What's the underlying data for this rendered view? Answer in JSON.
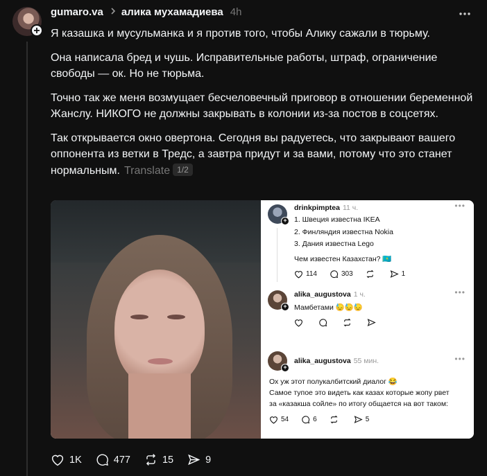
{
  "post": {
    "username": "gumaro.va",
    "reply_to": "алика мухамадиева",
    "time": "4h",
    "paragraphs": [
      "Я казашка и мусульманка и я против того, чтобы Алику сажали в тюрьму.",
      "Она написала бред и чушь. Исправительные работы, штраф, ограничение свободы — ок. Но не тюрьма.",
      "Точно так же меня возмущает бесчеловечный приговор в отношении беременной Жанслу. НИКОГО не должны закрывать в колонии из-за постов в соцсетях.",
      "Так открывается окно овертона. Сегодня вы радуетесь, что закрывают вашего оппонента из ветки в Тредс, а завтра придут и за вами, потому что это станет нормальным."
    ],
    "translate_label": "Translate",
    "pager": "1/2",
    "likes": "1K",
    "comments": "477",
    "reposts": "15",
    "shares": "9"
  },
  "screenshot": {
    "post1": {
      "name": "drinkpimptea",
      "time": "11 ч.",
      "lines": [
        "1. Швеция известна IKEA",
        "2. Финляндия известна Nokia",
        "3. Дания известна Lego",
        "Чем известен Казахстан? 🇰🇿"
      ],
      "likes": "114",
      "comments": "303",
      "shares": "1"
    },
    "post2": {
      "name": "alika_augustova",
      "time": "1 ч.",
      "text": "Мамбетами 😓😓😓"
    },
    "post3": {
      "name": "alika_augustova",
      "time": "55 мин.",
      "lines": [
        "Ох уж этот полукалбитский диалог 😂",
        "Самое тупое это видеть как казах которые жопу рвет",
        "за «казакша сойле» по итогу общается на вот таком:"
      ],
      "likes": "54",
      "comments": "6",
      "shares": "5"
    }
  }
}
